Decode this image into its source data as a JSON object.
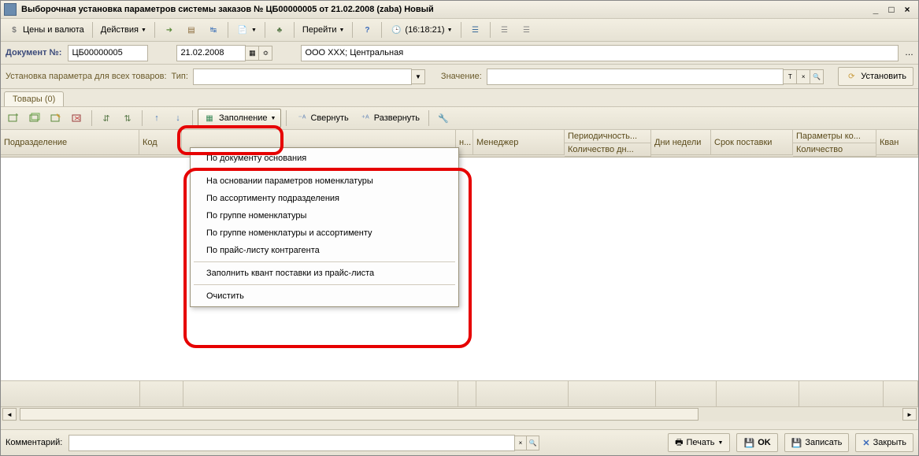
{
  "title": "Выборочная установка параметров системы заказов № ЦБ00000005 от 21.02.2008 (zaba) Новый",
  "toolbar": {
    "prices": "Цены и валюта",
    "actions": "Действия",
    "go": "Перейти",
    "clock": "(16:18:21)"
  },
  "doc": {
    "numLabel": "Документ №:",
    "num": "ЦБ00000005",
    "date": "21.02.2008",
    "org": "ООО XXX; Центральная"
  },
  "param": {
    "label": "Установка параметра для всех товаров:",
    "type": "Тип:",
    "value": "Значение:",
    "set": "Установить"
  },
  "tab": "Товары (0)",
  "sub": {
    "fill": "Заполнение",
    "collapse": "Свернуть",
    "expand": "Развернуть"
  },
  "menu": {
    "m1": "По документу основания",
    "m2": "На основании параметров номенклатуры",
    "m3": "По ассортименту подразделения",
    "m4": "По группе номенклатуры",
    "m5": "По группе номенклатуры и ассортименту",
    "m6": "По прайс-листу контрагента",
    "m7": "Заполнить квант поставки из прайс-листа",
    "m8": "Очистить"
  },
  "cols": {
    "pod": "Подразделение",
    "kod": "Код",
    "nomen": "н...",
    "manager": "Менеджер",
    "period1": "Периодичность...",
    "period2": "Количество дн...",
    "days": "Дни недели",
    "srok": "Срок поставки",
    "param1": "Параметры ко...",
    "param2": "Количество",
    "kvant": "Кван"
  },
  "bottom": {
    "comment": "Комментарий:",
    "print": "Печать",
    "ok": "OK",
    "save": "Записать",
    "close": "Закрыть"
  }
}
